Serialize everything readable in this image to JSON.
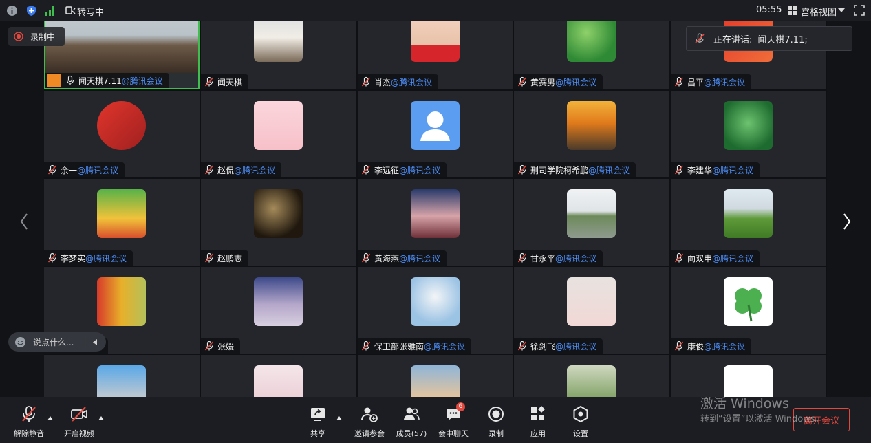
{
  "topbar": {
    "transcribe_label": "转写中",
    "time": "05:55",
    "view_mode": "宫格视图"
  },
  "recording": {
    "label": "录制中"
  },
  "speaking": {
    "label": "正在讲话:",
    "name": "闻天棋7.11;"
  },
  "tag_text": "@腾讯会议",
  "participants": [
    {
      "name": "闻天棋7.11",
      "tag": true,
      "avatar": "conference-room"
    },
    {
      "name": "闻天棋",
      "tag": false,
      "avatar": "woman-photo"
    },
    {
      "name": "肖杰",
      "tag": true,
      "avatar": "baby-wuhan"
    },
    {
      "name": "黄赛男",
      "tag": true,
      "avatar": "green-leaves"
    },
    {
      "name": "昌平",
      "tag": true,
      "avatar": "red-flag"
    },
    {
      "name": "余一",
      "tag": true,
      "avatar": "china-flag-circle"
    },
    {
      "name": "赵侃",
      "tag": true,
      "avatar": "cartoon-girl"
    },
    {
      "name": "李远征",
      "tag": true,
      "avatar": "default-user"
    },
    {
      "name": "刑司学院柯希鹏",
      "tag": true,
      "avatar": "wave-sunset"
    },
    {
      "name": "李建华",
      "tag": true,
      "avatar": "lotus-leaf"
    },
    {
      "name": "李梦实",
      "tag": true,
      "avatar": "cartoon-boy"
    },
    {
      "name": "赵鹏志",
      "tag": false,
      "avatar": "leopard"
    },
    {
      "name": "黄海燕",
      "tag": true,
      "avatar": "pixel-character"
    },
    {
      "name": "甘永平",
      "tag": true,
      "avatar": "grass-road"
    },
    {
      "name": "向双申",
      "tag": true,
      "avatar": "football-field"
    },
    {
      "name": "",
      "tag": true,
      "avatar": "fruits"
    },
    {
      "name": "张媛",
      "tag": false,
      "avatar": "starry-room"
    },
    {
      "name": "保卫部张雅南",
      "tag": true,
      "avatar": "blossoms"
    },
    {
      "name": "徐剑飞",
      "tag": true,
      "avatar": "baby-girl"
    },
    {
      "name": "康俊",
      "tag": true,
      "avatar": "clover"
    },
    {
      "name": "",
      "tag": false,
      "avatar": "cartoon-face"
    },
    {
      "name": "",
      "tag": false,
      "avatar": "baby-hat"
    },
    {
      "name": "",
      "tag": false,
      "avatar": "beach-sunset"
    },
    {
      "name": "",
      "tag": false,
      "avatar": "child-park"
    },
    {
      "name": "",
      "tag": false,
      "avatar": "text-image"
    }
  ],
  "chat_input": {
    "placeholder": "说点什么..."
  },
  "toolbar": {
    "unmute": "解除静音",
    "start_video": "开启视频",
    "share": "共享",
    "invite": "邀请参会",
    "members": "成员(57)",
    "chat": "会中聊天",
    "chat_badge": "6",
    "record": "录制",
    "apps": "应用",
    "settings": "设置",
    "leave": "离开会议"
  },
  "watermark": {
    "line1": "激活 Windows",
    "line2": "转到“设置”以激活 Windows。"
  },
  "colors": {
    "accent": "#4c8cf5",
    "active_border": "#3fbe4f",
    "leave": "#e2483d",
    "mic_muted": "#e2483d"
  }
}
